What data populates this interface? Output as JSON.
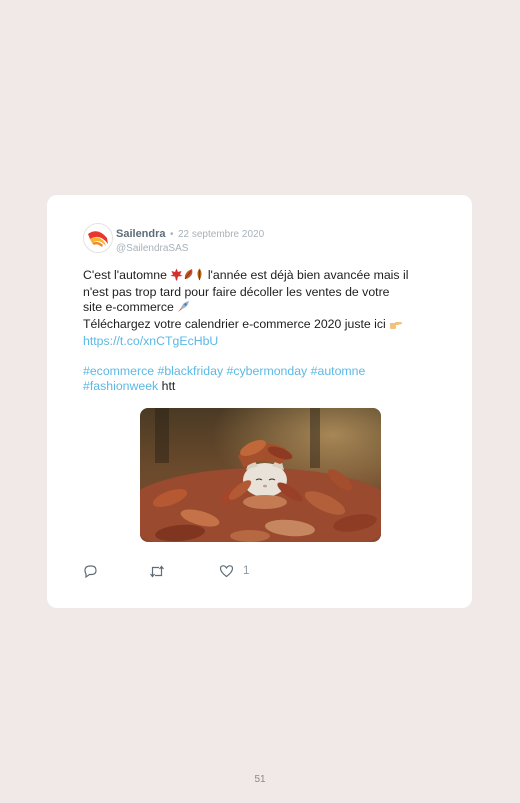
{
  "tweet": {
    "author": "Sailendra",
    "separator": "•",
    "date": "22 septembre 2020",
    "handle": "@SailendraSAS",
    "text": {
      "line1_a": "C'est l'automne",
      "line1_b": "l'année est déjà bien avancée mais il",
      "line2": "n'est pas trop tard pour faire décoller les ventes de votre",
      "line3": "site e-commerce",
      "line4": "Téléchargez votre calendrier e-commerce 2020 juste ici",
      "link": "https://t.co/xnCTgEcHbU",
      "hashtags": [
        "#ecommerce",
        "#blackfriday",
        "#cybermonday",
        "#automne",
        "#fashionweek"
      ],
      "trailing": "htt"
    },
    "media": {
      "description_icon": "autumn-leaves-cat-photo"
    },
    "actions": {
      "reply_icon": "reply-icon",
      "retweet_icon": "retweet-icon",
      "like_icon": "heart-icon",
      "like_count": "1"
    }
  },
  "page": {
    "number": "51"
  },
  "colors": {
    "background": "#f1e9e7",
    "card": "#ffffff",
    "link": "#5cb8e4",
    "muted": "#a8b1ba",
    "brand_red": "#e8372f",
    "brand_yellow": "#f6b52e"
  }
}
